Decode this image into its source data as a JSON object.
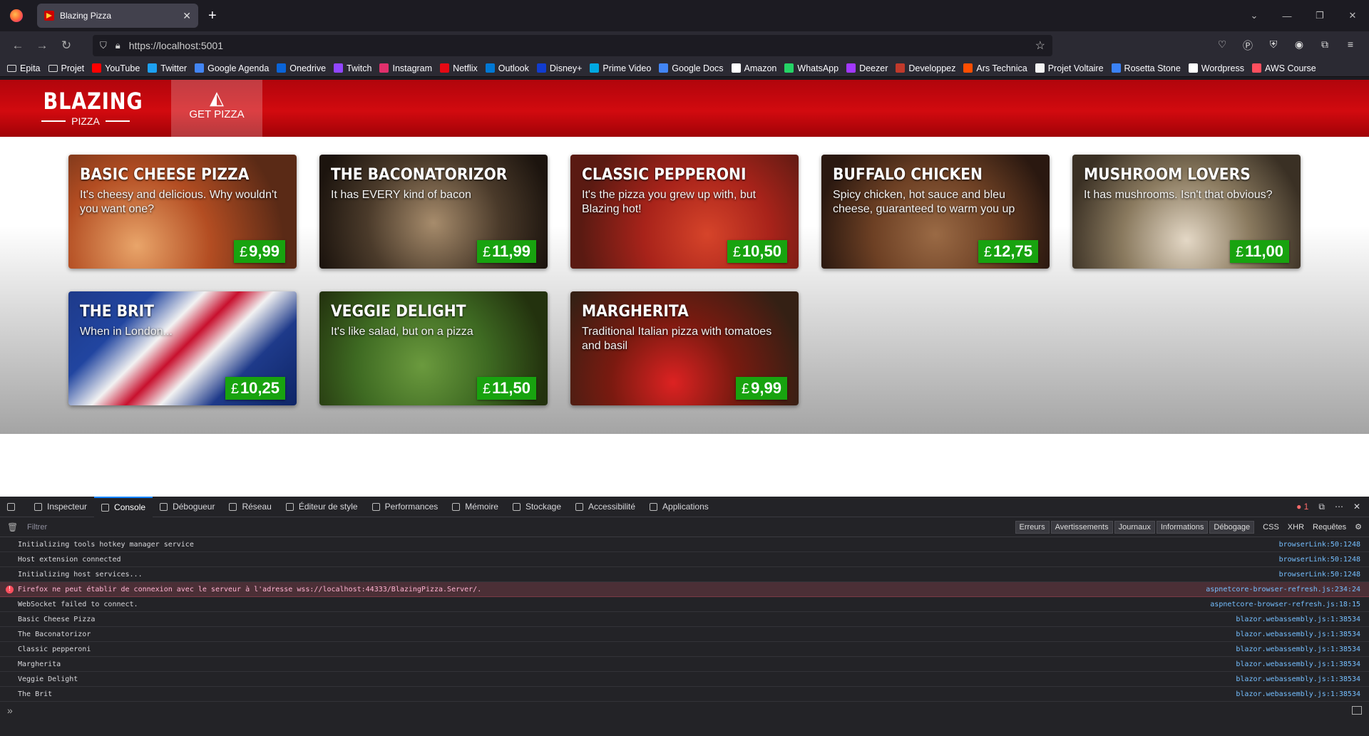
{
  "browser": {
    "tab_title": "Blazing Pizza",
    "url": "https://localhost:5001"
  },
  "bookmarks": [
    {
      "label": "Epita",
      "color": "#2b2a33",
      "icon": "folder-icon"
    },
    {
      "label": "Projet",
      "color": "#2b2a33",
      "icon": "folder-icon"
    },
    {
      "label": "YouTube",
      "color": "#ff0000",
      "icon": "youtube-icon"
    },
    {
      "label": "Twitter",
      "color": "#1da1f2",
      "icon": "twitter-icon"
    },
    {
      "label": "Google Agenda",
      "color": "#4285f4",
      "icon": "calendar-icon"
    },
    {
      "label": "Onedrive",
      "color": "#0a64d8",
      "icon": "cloud-icon"
    },
    {
      "label": "Twitch",
      "color": "#9146ff",
      "icon": "twitch-icon"
    },
    {
      "label": "Instagram",
      "color": "#e1306c",
      "icon": "instagram-icon"
    },
    {
      "label": "Netflix",
      "color": "#e50914",
      "icon": "netflix-icon"
    },
    {
      "label": "Outlook",
      "color": "#0078d4",
      "icon": "outlook-icon"
    },
    {
      "label": "Disney+",
      "color": "#113ccf",
      "icon": "disney-icon"
    },
    {
      "label": "Prime Video",
      "color": "#00a8e1",
      "icon": "prime-video-icon"
    },
    {
      "label": "Google Docs",
      "color": "#4285f4",
      "icon": "docs-icon"
    },
    {
      "label": "Amazon",
      "color": "#ffffff",
      "icon": "amazon-icon"
    },
    {
      "label": "WhatsApp",
      "color": "#25d366",
      "icon": "whatsapp-icon"
    },
    {
      "label": "Deezer",
      "color": "#a238ff",
      "icon": "deezer-icon"
    },
    {
      "label": "Developpez",
      "color": "#c0392b",
      "icon": "developpez-icon"
    },
    {
      "label": "Ars Technica",
      "color": "#ff4e00",
      "icon": "ars-icon"
    },
    {
      "label": "Projet Voltaire",
      "color": "#f5f5f5",
      "icon": "voltaire-icon"
    },
    {
      "label": "Rosetta Stone",
      "color": "#3b82f6",
      "icon": "rosetta-icon"
    },
    {
      "label": "Wordpress",
      "color": "#ffffff",
      "icon": "wordpress-icon"
    },
    {
      "label": "AWS Course",
      "color": "#ff4f5e",
      "icon": "aws-icon"
    }
  ],
  "app": {
    "logo_main": "BLAZING",
    "logo_sub": "PIZZA",
    "nav_get_pizza": "GET PIZZA",
    "currency": "£",
    "price_color": "#18a30f",
    "header_color": "#c00008"
  },
  "specials": [
    {
      "name": "BASIC CHEESE PIZZA",
      "desc": "It's cheesy and delicious. Why wouldn't you want one?",
      "price": "9,99"
    },
    {
      "name": "THE BACONATORIZOR",
      "desc": "It has EVERY kind of bacon",
      "price": "11,99"
    },
    {
      "name": "CLASSIC PEPPERONI",
      "desc": "It's the pizza you grew up with, but Blazing hot!",
      "price": "10,50"
    },
    {
      "name": "BUFFALO CHICKEN",
      "desc": "Spicy chicken, hot sauce and bleu cheese, guaranteed to warm you up",
      "price": "12,75"
    },
    {
      "name": "MUSHROOM LOVERS",
      "desc": "It has mushrooms. Isn't that obvious?",
      "price": "11,00"
    },
    {
      "name": "THE BRIT",
      "desc": "When in London...",
      "price": "10,25"
    },
    {
      "name": "VEGGIE DELIGHT",
      "desc": "It's like salad, but on a pizza",
      "price": "11,50"
    },
    {
      "name": "MARGHERITA",
      "desc": "Traditional Italian pizza with tomatoes and basil",
      "price": "9,99"
    }
  ],
  "devtools": {
    "tabs": [
      "Inspecteur",
      "Console",
      "Débogueur",
      "Réseau",
      "Éditeur de style",
      "Performances",
      "Mémoire",
      "Stockage",
      "Accessibilité",
      "Applications"
    ],
    "error_count": "1",
    "filter_placeholder": "Filtrer",
    "filters": [
      "Erreurs",
      "Avertissements",
      "Journaux",
      "Informations",
      "Débogage"
    ],
    "filters2": [
      "CSS",
      "XHR",
      "Requêtes"
    ],
    "logs": [
      {
        "msg": "Initializing tools hotkey manager service",
        "src": "browserLink:50:1248",
        "type": "log"
      },
      {
        "msg": "Host extension connected",
        "src": "browserLink:50:1248",
        "type": "log"
      },
      {
        "msg": "Initializing host services...",
        "src": "browserLink:50:1248",
        "type": "log"
      },
      {
        "msg": "Firefox ne peut établir de connexion avec le serveur à l'adresse wss://localhost:44333/BlazingPizza.Server/.",
        "src": "aspnetcore-browser-refresh.js:234:24",
        "type": "error"
      },
      {
        "msg": "WebSocket failed to connect.",
        "src": "aspnetcore-browser-refresh.js:18:15",
        "type": "log"
      },
      {
        "msg": "Basic Cheese Pizza",
        "src": "blazor.webassembly.js:1:38534",
        "type": "log"
      },
      {
        "msg": "The Baconatorizor",
        "src": "blazor.webassembly.js:1:38534",
        "type": "log"
      },
      {
        "msg": "Classic pepperoni",
        "src": "blazor.webassembly.js:1:38534",
        "type": "log"
      },
      {
        "msg": "Margherita",
        "src": "blazor.webassembly.js:1:38534",
        "type": "log"
      },
      {
        "msg": "Veggie Delight",
        "src": "blazor.webassembly.js:1:38534",
        "type": "log"
      },
      {
        "msg": "The Brit",
        "src": "blazor.webassembly.js:1:38534",
        "type": "log"
      }
    ]
  }
}
